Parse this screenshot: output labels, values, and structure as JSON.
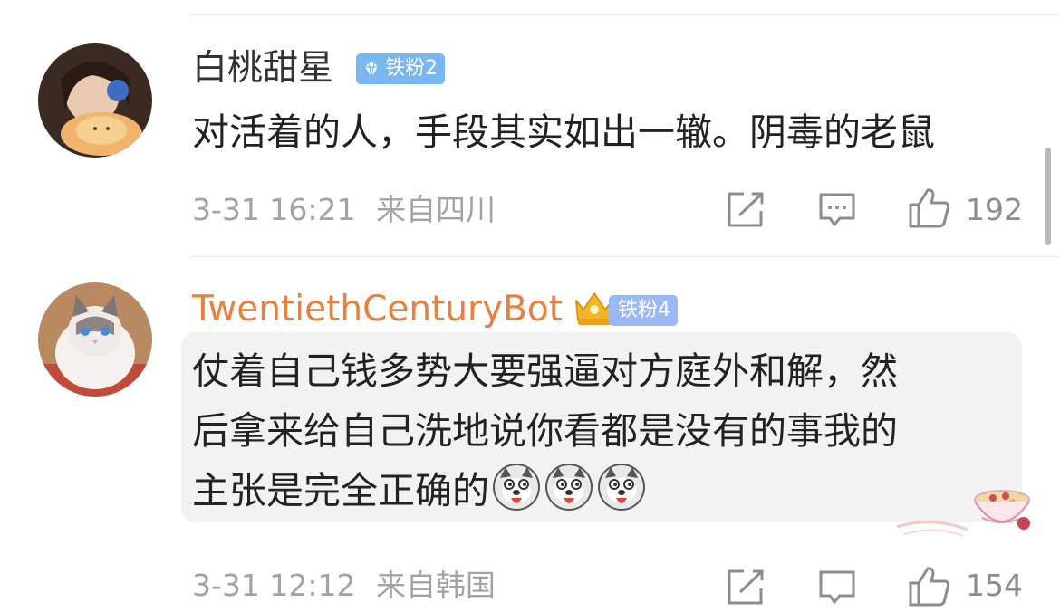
{
  "comments": [
    {
      "username": "白桃甜星",
      "badge": "铁粉2",
      "text": "对活着的人，手段其实如出一辙。阴毒的老鼠",
      "time": "3-31 16:21",
      "location": "来自四川",
      "likes": "192",
      "username_color": "#333333"
    },
    {
      "username": "TwentiethCenturyBot",
      "badge": "铁粉4",
      "text_lines": [
        "仗着自己钱多势大要强逼对方庭外和解，然",
        "后拿来给自己洗地说你看都是没有的事我的",
        "主张是完全正确的"
      ],
      "emoji": [
        "doge-icon",
        "doge-icon",
        "doge-icon"
      ],
      "time": "3-31 12:12",
      "location": "来自韩国",
      "likes": "154",
      "username_color": "#e8803e"
    }
  ],
  "icons": [
    "share-icon",
    "comment-icon",
    "like-icon"
  ],
  "colors": {
    "accent_orange": "#e8803e",
    "badge_blue": "#79b7f2",
    "meta_gray": "#a3a3a3"
  }
}
